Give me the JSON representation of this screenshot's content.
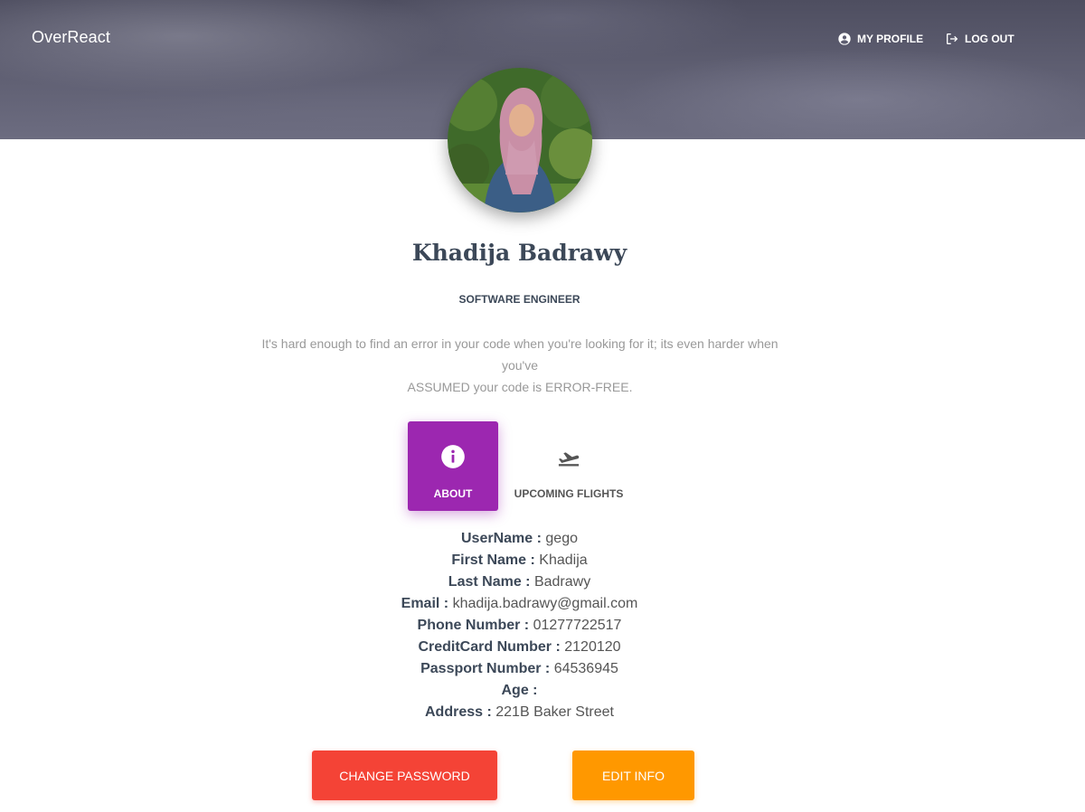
{
  "navbar": {
    "brand": "OverReact",
    "my_profile": {
      "label": "MY PROFILE",
      "icon": "account-circle-icon"
    },
    "logout": {
      "label": "LOG OUT",
      "icon": "logout-icon"
    }
  },
  "profile": {
    "name": "Khadija Badrawy",
    "title": "SOFTWARE ENGINEER",
    "quote_line1": "It's hard enough to find an error in your code when you're looking for it; its even harder when you've",
    "quote_line2": "ASSUMED your code is ERROR-FREE."
  },
  "tabs": [
    {
      "label": "ABOUT",
      "icon": "info-icon",
      "active": true
    },
    {
      "label": "UPCOMING FLIGHTS",
      "icon": "flight-takeoff-icon",
      "active": false
    }
  ],
  "details": [
    {
      "label": "UserName :",
      "value": "gego"
    },
    {
      "label": "First Name :",
      "value": "Khadija"
    },
    {
      "label": "Last Name :",
      "value": "Badrawy"
    },
    {
      "label": "Email :",
      "value": "khadija.badrawy@gmail.com"
    },
    {
      "label": "Phone Number :",
      "value": "01277722517"
    },
    {
      "label": "CreditCard Number :",
      "value": "2120120"
    },
    {
      "label": "Passport Number :",
      "value": "64536945"
    },
    {
      "label": "Age :",
      "value": ""
    },
    {
      "label": "Address :",
      "value": "221B Baker Street"
    }
  ],
  "actions": {
    "change_password": "CHANGE PASSWORD",
    "edit_info": "EDIT INFO"
  },
  "colors": {
    "primary_purple": "#9c27b0",
    "danger_red": "#f44336",
    "warning_orange": "#ff9800",
    "heading": "#3c4858",
    "muted": "#999999"
  }
}
